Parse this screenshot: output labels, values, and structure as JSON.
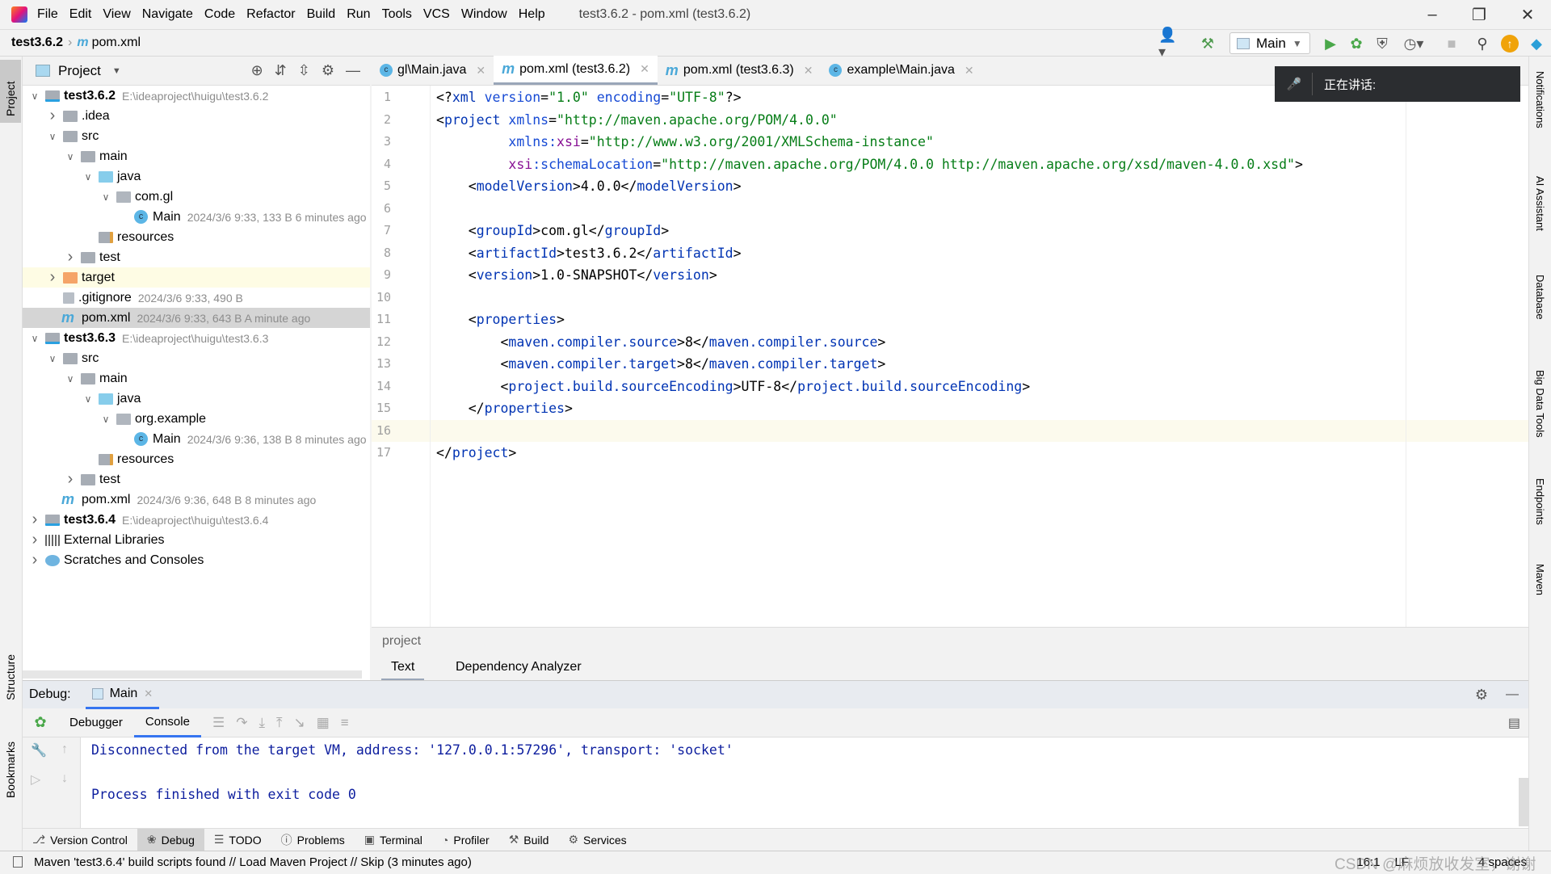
{
  "menu": [
    "File",
    "Edit",
    "View",
    "Navigate",
    "Code",
    "Refactor",
    "Build",
    "Run",
    "Tools",
    "VCS",
    "Window",
    "Help"
  ],
  "window_title": "test3.6.2 - pom.xml (test3.6.2)",
  "breadcrumb": {
    "project": "test3.6.2",
    "file": "pom.xml"
  },
  "run_config": "Main",
  "project_panel": {
    "title": "Project"
  },
  "tree": [
    {
      "level": 0,
      "arrow": "open",
      "icon": "module",
      "name": "test3.6.2",
      "bold": true,
      "extra": "E:\\ideaproject\\huigu\\test3.6.2"
    },
    {
      "level": 1,
      "arrow": "closed",
      "icon": "folder",
      "name": ".idea"
    },
    {
      "level": 1,
      "arrow": "open",
      "icon": "folder",
      "name": "src"
    },
    {
      "level": 2,
      "arrow": "open",
      "icon": "folder",
      "name": "main"
    },
    {
      "level": 3,
      "arrow": "open",
      "icon": "src-folder",
      "name": "java"
    },
    {
      "level": 4,
      "arrow": "open",
      "icon": "package",
      "name": "com.gl"
    },
    {
      "level": 5,
      "arrow": "none",
      "icon": "class",
      "name": "Main",
      "extra": "2024/3/6 9:33, 133 B 6 minutes ago"
    },
    {
      "level": 3,
      "arrow": "none",
      "icon": "res-folder",
      "name": "resources"
    },
    {
      "level": 2,
      "arrow": "closed",
      "icon": "folder",
      "name": "test"
    },
    {
      "level": 1,
      "arrow": "closed",
      "icon": "excluded-folder",
      "name": "target",
      "highlight": "yellow"
    },
    {
      "level": 1,
      "arrow": "none",
      "icon": "gitignore",
      "name": ".gitignore",
      "extra": "2024/3/6 9:33, 490 B"
    },
    {
      "level": 1,
      "arrow": "none",
      "icon": "maven",
      "name": "pom.xml",
      "extra": "2024/3/6 9:33, 643 B A minute ago",
      "highlight": "selected"
    },
    {
      "level": 0,
      "arrow": "open",
      "icon": "module",
      "name": "test3.6.3",
      "bold": true,
      "extra": "E:\\ideaproject\\huigu\\test3.6.3"
    },
    {
      "level": 1,
      "arrow": "open",
      "icon": "folder",
      "name": "src"
    },
    {
      "level": 2,
      "arrow": "open",
      "icon": "folder",
      "name": "main"
    },
    {
      "level": 3,
      "arrow": "open",
      "icon": "src-folder",
      "name": "java"
    },
    {
      "level": 4,
      "arrow": "open",
      "icon": "package",
      "name": "org.example"
    },
    {
      "level": 5,
      "arrow": "none",
      "icon": "class",
      "name": "Main",
      "extra": "2024/3/6 9:36, 138 B 8 minutes ago"
    },
    {
      "level": 3,
      "arrow": "none",
      "icon": "res-folder",
      "name": "resources"
    },
    {
      "level": 2,
      "arrow": "closed",
      "icon": "folder",
      "name": "test"
    },
    {
      "level": 1,
      "arrow": "none",
      "icon": "maven",
      "name": "pom.xml",
      "extra": "2024/3/6 9:36, 648 B 8 minutes ago"
    },
    {
      "level": 0,
      "arrow": "closed",
      "icon": "module",
      "name": "test3.6.4",
      "bold": true,
      "extra": "E:\\ideaproject\\huigu\\test3.6.4"
    },
    {
      "level": 0,
      "arrow": "closed",
      "icon": "libraries",
      "name": "External Libraries"
    },
    {
      "level": 0,
      "arrow": "closed",
      "icon": "scratches",
      "name": "Scratches and Consoles"
    }
  ],
  "tabs": [
    {
      "label": "gl\\Main.java",
      "icon": "class",
      "active": false
    },
    {
      "label": "pom.xml (test3.6.2)",
      "icon": "maven",
      "active": true
    },
    {
      "label": "pom.xml (test3.6.3)",
      "icon": "maven",
      "active": false
    },
    {
      "label": "example\\Main.java",
      "icon": "class",
      "active": false
    }
  ],
  "code": [
    "<?xml version=\"1.0\" encoding=\"UTF-8\"?>",
    "<project xmlns=\"http://maven.apache.org/POM/4.0.0\"",
    "         xmlns:xsi=\"http://www.w3.org/2001/XMLSchema-instance\"",
    "         xsi:schemaLocation=\"http://maven.apache.org/POM/4.0.0 http://maven.apache.org/xsd/maven-4.0.0.xsd\">",
    "    <modelVersion>4.0.0</modelVersion>",
    "",
    "    <groupId>com.gl</groupId>",
    "    <artifactId>test3.6.2</artifactId>",
    "    <version>1.0-SNAPSHOT</version>",
    "",
    "    <properties>",
    "        <maven.compiler.source>8</maven.compiler.source>",
    "        <maven.compiler.target>8</maven.compiler.target>",
    "        <project.build.sourceEncoding>UTF-8</project.build.sourceEncoding>",
    "    </properties>",
    "",
    "</project>"
  ],
  "current_line": 16,
  "editor_breadcrumb": "project",
  "editor_bottom_tabs": [
    "Text",
    "Dependency Analyzer"
  ],
  "notification": {
    "text": "正在讲话:"
  },
  "debug": {
    "label": "Debug:",
    "session": "Main",
    "tabs": [
      "Debugger",
      "Console"
    ],
    "console": [
      "Disconnected from the target VM, address: '127.0.0.1:57296', transport: 'socket'",
      "Process finished with exit code 0"
    ]
  },
  "bottom_tools": [
    "Version Control",
    "Debug",
    "TODO",
    "Problems",
    "Terminal",
    "Profiler",
    "Build",
    "Services"
  ],
  "left_strip": [
    "Project",
    "Structure",
    "Bookmarks"
  ],
  "right_strip": [
    "Notifications",
    "AI Assistant",
    "Database",
    "Big Data Tools",
    "Endpoints",
    "Maven"
  ],
  "status": {
    "message": "Maven 'test3.6.4' build scripts found // Load Maven Project // Skip (3 minutes ago)",
    "position": "16:1",
    "line_sep": "LF",
    "indent": "4 spaces",
    "watermark": "CSDN @麻烦放收发室，谢谢"
  },
  "colors": {
    "accent": "#3574f0",
    "tag": "#0033b3",
    "attr": "#174ad4",
    "string": "#067d17",
    "namespace": "#871094",
    "console": "#0c1d9e"
  }
}
